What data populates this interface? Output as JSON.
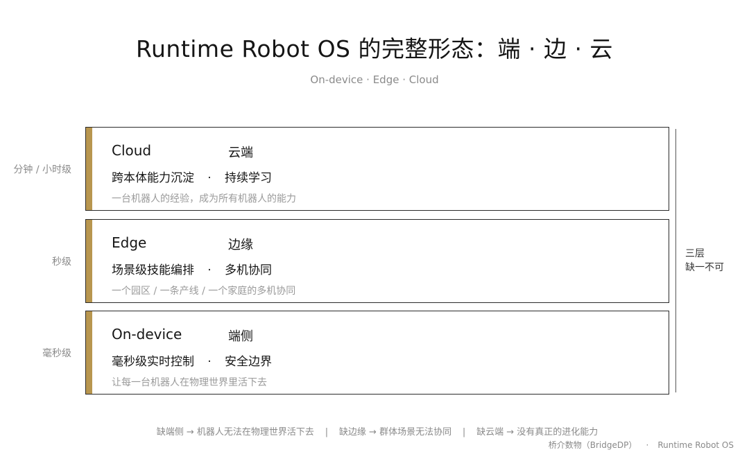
{
  "header": {
    "title": "Runtime Robot OS 的完整形态：端 · 边 · 云",
    "subtitle": "On-device · Edge · Cloud"
  },
  "layers": [
    {
      "name": "Cloud",
      "cn": "云端",
      "cap1": "跨本体能力沉淀",
      "cap2": "持续学习",
      "desc": "一台机器人的经验，成为所有机器人的能力",
      "timescale": "分钟 / 小时级"
    },
    {
      "name": "Edge",
      "cn": "边缘",
      "cap1": "场景级技能编排",
      "cap2": "多机协同",
      "desc": "一个园区 / 一条产线 / 一个家庭的多机协同",
      "timescale": "秒级"
    },
    {
      "name": "On-device",
      "cn": "端侧",
      "cap1": "毫秒级实时控制",
      "cap2": "安全边界",
      "desc": "让每一台机器人在物理世界里活下去",
      "timescale": "毫秒级"
    }
  ],
  "dot": "·",
  "side_label": {
    "line1": "三层",
    "line2": "缺一不可"
  },
  "footer": {
    "item1": "缺端侧 → 机器人无法在物理世界活下去",
    "item2": "缺边缘 → 群体场景无法协同",
    "item3": "缺云端 → 没有真正的进化能力",
    "separator": "|"
  },
  "credit": {
    "author": "桥介数物（BridgeDP）",
    "product": "Runtime Robot OS"
  },
  "colors": {
    "accent_bar": "#b8964f",
    "border": "#2a2a2a",
    "muted_text": "#8a8a8a"
  }
}
